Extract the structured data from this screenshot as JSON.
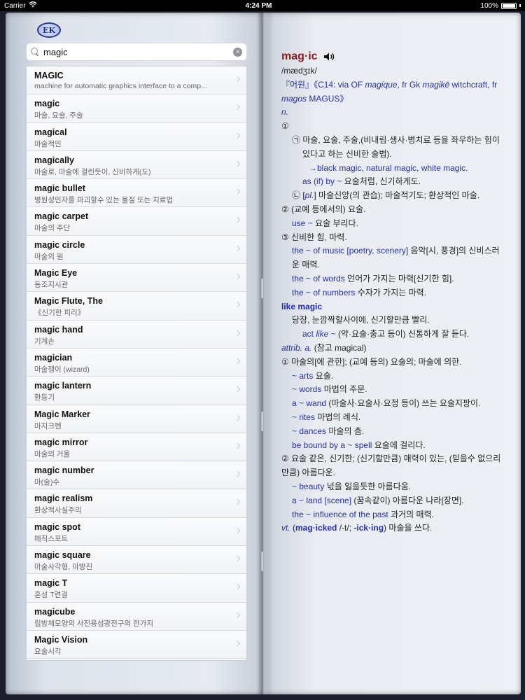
{
  "status": {
    "carrier": "Carrier",
    "time": "4:24 PM",
    "battery": "100%"
  },
  "logo": "EK",
  "search": {
    "value": "magic"
  },
  "results": [
    {
      "term": "MAGIC",
      "def": "machine for automatic graphics interface to a comp..."
    },
    {
      "term": "magic",
      "def": "마술, 요술, 주술"
    },
    {
      "term": "magical",
      "def": "마술적인"
    },
    {
      "term": "magically",
      "def": "마술로, 마술에 걸린듯이, 신비하게(도)"
    },
    {
      "term": "magic bullet",
      "def": "병원성인자를 파괴할수 있는 물질 또는 치료법"
    },
    {
      "term": "magic carpet",
      "def": "마술의 주단"
    },
    {
      "term": "magic circle",
      "def": "마술의 원"
    },
    {
      "term": "Magic Eye",
      "def": "동조지시관"
    },
    {
      "term": "Magic Flute, The",
      "def": "《신기한 피리》"
    },
    {
      "term": "magic hand",
      "def": "기계손"
    },
    {
      "term": "magician",
      "def": "마술쟁이 (wizard)"
    },
    {
      "term": "magic lantern",
      "def": "환등기"
    },
    {
      "term": "Magic Marker",
      "def": "마지크펜"
    },
    {
      "term": "magic mirror",
      "def": "마술의 거울"
    },
    {
      "term": "magic number",
      "def": "마(술)수"
    },
    {
      "term": "magic realism",
      "def": "환상적사실주의"
    },
    {
      "term": "magic spot",
      "def": "매직스포트"
    },
    {
      "term": "magic square",
      "def": "마술사각형, 마방진"
    },
    {
      "term": "magic T",
      "def": "혼성 T련결"
    },
    {
      "term": "magicube",
      "def": "립방체모양의 사진용섬광전구의 한가지"
    },
    {
      "term": "Magic Vision",
      "def": "요술시각"
    }
  ],
  "entry": {
    "headword": "mag·ic",
    "pron": "/mædʒɪk/",
    "etym_open": "『어원』",
    "etym_a": "《C14: via OF ",
    "etym_b": "magique",
    "etym_c": ", fr Gk ",
    "etym_d": "magikē",
    "etym_e": " witchcraft, fr",
    "etym_f": "magos",
    "etym_g": " MAGUS》",
    "pos_n": "n.",
    "s1": "①",
    "s1a": "㉠ 마술, 요술, 주술,(비내림·생사·병치료 등을 좌우하는 힘이 있다고 하는 신비한 술법).",
    "s1a_ref_arrow": "→",
    "s1a_ref": "black magic, natural magic, white magic.",
    "s1a_ex_en": "as (if) by ~",
    "s1a_ex_ko": " 요술처럼, 신기하게도.",
    "s1b_a": "㉡ [",
    "s1b_pl": "pl.",
    "s1b_b": "] 마술신앙(의 관습); 마술적기도; 환상적인 마술.",
    "s2": "② (교예 등에서의) 요술.",
    "s2_ex_en": "use ~",
    "s2_ex_ko": " 요술 부리다.",
    "s3": "③ 신비한 힘, 마력.",
    "s3_ex1_en": "the ~ of music [poetry, scenery]",
    "s3_ex1_ko": " 음악[시, 풍경]의 신비스러운 매력.",
    "s3_ex2_en": "the ~ of words",
    "s3_ex2_ko": " 언어가 가지는 마력[신기한 힘].",
    "s3_ex3_en": "the ~ of numbers",
    "s3_ex3_ko": " 수자가 가지는 마력.",
    "idiom": "like magic",
    "idiom_def": "당장, 눈깜짝할사이에, 신기할만큼 빨리.",
    "idiom_ex_a": "act ",
    "idiom_ex_like": "like",
    "idiom_ex_b": " ~",
    "idiom_ex_ko": " (약·요술·충고 등이) 신통하게 잘 듣다.",
    "attrib": "attrib. a.",
    "attrib_ref": " (참고 magical)",
    "a1": "① 마술의[에 관한]; (교예 등의) 요술의; 마술에 의한.",
    "a1_ex1_en": "~ arts",
    "a1_ex1_ko": " 요술.",
    "a1_ex2_en": "~ words",
    "a1_ex2_ko": " 마법의 주문.",
    "a1_ex3_en": "a ~ wand",
    "a1_ex3_ko": " (마술사·요술사·요정 등이) 쓰는 요술지팡이.",
    "a1_ex4_en": "~ rites",
    "a1_ex4_ko": " 마법의 례식.",
    "a1_ex5_en": "~ dances",
    "a1_ex5_ko": " 마술의 춤.",
    "a1_ex6_en": "be bound by a ~ spell",
    "a1_ex6_ko": " 요술에 걸리다.",
    "a2": "② 요술 같은, 신기한; (신기할만큼) 매력이 있는, (믿을수 없으리만큼) 아름다운.",
    "a2_ex1_en": "~ beauty",
    "a2_ex1_ko": " 넋을 잃을듯한 아름다움.",
    "a2_ex2_en": "a ~ land [scene]",
    "a2_ex2_ko": " (꿈속같이) 아름다운 나라[장면].",
    "a2_ex3_en": "the ~ influence of the past",
    "a2_ex3_ko": " 과거의 매력.",
    "vt": "vt.",
    "vt_a": " (",
    "vt_pp": "mag·icked",
    "vt_b": " /-t/; ",
    "vt_ing": "-ick·ing",
    "vt_c": ")",
    "vt_ko": " 마술을 쓰다."
  }
}
